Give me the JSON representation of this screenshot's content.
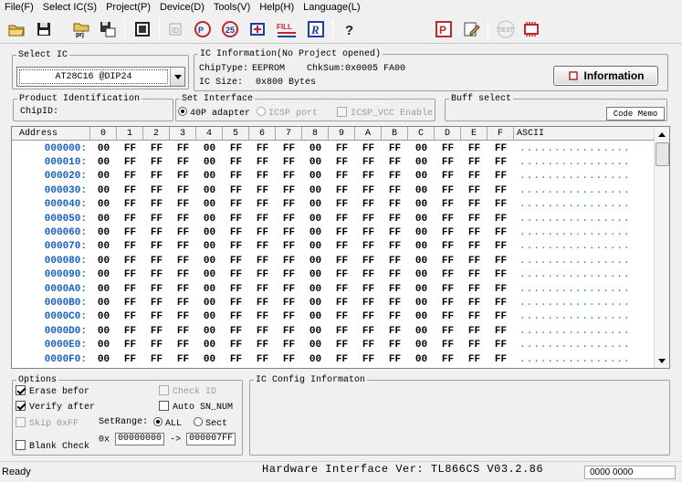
{
  "menu": [
    "File(F)",
    "Select IC(S)",
    "Project(P)",
    "Device(D)",
    "Tools(V)",
    "Help(H)",
    "Language(L)"
  ],
  "toolbar": {
    "prj_label": "prj",
    "fill_label": "FILL",
    "read_label": "R",
    "test_label": "TEST",
    "help_label": "?"
  },
  "select_ic": {
    "legend": "Select IC",
    "value": "AT28C16 @DIP24"
  },
  "ic_info": {
    "legend": "IC Information(No Project opened)",
    "chip_type_label": "ChipType:",
    "chip_type": "EEPROM",
    "checksum_label": "ChkSum:",
    "checksum": "0x0005 FA00",
    "ic_size_label": "IC Size:",
    "ic_size": "0x800 Bytes",
    "button": "Information"
  },
  "product_id": {
    "legend": "Product Identification",
    "chip_id_label": "ChipID:"
  },
  "interface": {
    "legend": "Set Interface",
    "opt_40p": "40P adapter",
    "opt_icsp": "ICSP port",
    "opt_icsp_vcc": "ICSP_VCC Enable"
  },
  "buff": {
    "legend": "Buff select",
    "value": "Code Memo"
  },
  "grid": {
    "address_header": "Address",
    "columns": [
      "0",
      "1",
      "2",
      "3",
      "4",
      "5",
      "6",
      "7",
      "8",
      "9",
      "A",
      "B",
      "C",
      "D",
      "E",
      "F"
    ],
    "ascii_header": "ASCII",
    "rows": [
      {
        "addr": "000000:",
        "bytes": [
          "00",
          "FF",
          "FF",
          "FF",
          "00",
          "FF",
          "FF",
          "FF",
          "00",
          "FF",
          "FF",
          "FF",
          "00",
          "FF",
          "FF",
          "FF"
        ],
        "ascii": "................"
      },
      {
        "addr": "000010:",
        "bytes": [
          "00",
          "FF",
          "FF",
          "FF",
          "00",
          "FF",
          "FF",
          "FF",
          "00",
          "FF",
          "FF",
          "FF",
          "00",
          "FF",
          "FF",
          "FF"
        ],
        "ascii": "................"
      },
      {
        "addr": "000020:",
        "bytes": [
          "00",
          "FF",
          "FF",
          "FF",
          "00",
          "FF",
          "FF",
          "FF",
          "00",
          "FF",
          "FF",
          "FF",
          "00",
          "FF",
          "FF",
          "FF"
        ],
        "ascii": "................"
      },
      {
        "addr": "000030:",
        "bytes": [
          "00",
          "FF",
          "FF",
          "FF",
          "00",
          "FF",
          "FF",
          "FF",
          "00",
          "FF",
          "FF",
          "FF",
          "00",
          "FF",
          "FF",
          "FF"
        ],
        "ascii": "................"
      },
      {
        "addr": "000040:",
        "bytes": [
          "00",
          "FF",
          "FF",
          "FF",
          "00",
          "FF",
          "FF",
          "FF",
          "00",
          "FF",
          "FF",
          "FF",
          "00",
          "FF",
          "FF",
          "FF"
        ],
        "ascii": "................"
      },
      {
        "addr": "000050:",
        "bytes": [
          "00",
          "FF",
          "FF",
          "FF",
          "00",
          "FF",
          "FF",
          "FF",
          "00",
          "FF",
          "FF",
          "FF",
          "00",
          "FF",
          "FF",
          "FF"
        ],
        "ascii": "................"
      },
      {
        "addr": "000060:",
        "bytes": [
          "00",
          "FF",
          "FF",
          "FF",
          "00",
          "FF",
          "FF",
          "FF",
          "00",
          "FF",
          "FF",
          "FF",
          "00",
          "FF",
          "FF",
          "FF"
        ],
        "ascii": "................"
      },
      {
        "addr": "000070:",
        "bytes": [
          "00",
          "FF",
          "FF",
          "FF",
          "00",
          "FF",
          "FF",
          "FF",
          "00",
          "FF",
          "FF",
          "FF",
          "00",
          "FF",
          "FF",
          "FF"
        ],
        "ascii": "................"
      },
      {
        "addr": "000080:",
        "bytes": [
          "00",
          "FF",
          "FF",
          "FF",
          "00",
          "FF",
          "FF",
          "FF",
          "00",
          "FF",
          "FF",
          "FF",
          "00",
          "FF",
          "FF",
          "FF"
        ],
        "ascii": "................"
      },
      {
        "addr": "000090:",
        "bytes": [
          "00",
          "FF",
          "FF",
          "FF",
          "00",
          "FF",
          "FF",
          "FF",
          "00",
          "FF",
          "FF",
          "FF",
          "00",
          "FF",
          "FF",
          "FF"
        ],
        "ascii": "................"
      },
      {
        "addr": "0000A0:",
        "bytes": [
          "00",
          "FF",
          "FF",
          "FF",
          "00",
          "FF",
          "FF",
          "FF",
          "00",
          "FF",
          "FF",
          "FF",
          "00",
          "FF",
          "FF",
          "FF"
        ],
        "ascii": "................"
      },
      {
        "addr": "0000B0:",
        "bytes": [
          "00",
          "FF",
          "FF",
          "FF",
          "00",
          "FF",
          "FF",
          "FF",
          "00",
          "FF",
          "FF",
          "FF",
          "00",
          "FF",
          "FF",
          "FF"
        ],
        "ascii": "................"
      },
      {
        "addr": "0000C0:",
        "bytes": [
          "00",
          "FF",
          "FF",
          "FF",
          "00",
          "FF",
          "FF",
          "FF",
          "00",
          "FF",
          "FF",
          "FF",
          "00",
          "FF",
          "FF",
          "FF"
        ],
        "ascii": "................"
      },
      {
        "addr": "0000D0:",
        "bytes": [
          "00",
          "FF",
          "FF",
          "FF",
          "00",
          "FF",
          "FF",
          "FF",
          "00",
          "FF",
          "FF",
          "FF",
          "00",
          "FF",
          "FF",
          "FF"
        ],
        "ascii": "................"
      },
      {
        "addr": "0000E0:",
        "bytes": [
          "00",
          "FF",
          "FF",
          "FF",
          "00",
          "FF",
          "FF",
          "FF",
          "00",
          "FF",
          "FF",
          "FF",
          "00",
          "FF",
          "FF",
          "FF"
        ],
        "ascii": "................"
      },
      {
        "addr": "0000F0:",
        "bytes": [
          "00",
          "FF",
          "FF",
          "FF",
          "00",
          "FF",
          "FF",
          "FF",
          "00",
          "FF",
          "FF",
          "FF",
          "00",
          "FF",
          "FF",
          "FF"
        ],
        "ascii": "................"
      }
    ]
  },
  "options": {
    "legend": "Options",
    "erase": "Erase befor",
    "verify": "Verify after",
    "skip": "Skip 0xFF",
    "blank": "Blank Check",
    "check_id": "Check ID",
    "auto_sn": "Auto SN_NUM",
    "set_range": "SetRange:",
    "all": "ALL",
    "sect": "Sect",
    "prefix": "0x",
    "range_start": "00000000",
    "arrow": "->",
    "range_end": "000007FF"
  },
  "ic_config": {
    "legend": "IC Config Informaton"
  },
  "status": {
    "left": "Ready",
    "hardware": "Hardware Interface Ver: TL866CS V03.2.86",
    "right": "0000 0000"
  },
  "colors": {
    "address": "#1560c0",
    "ascii": "#1a78d0",
    "accent_red": "#c0282d"
  }
}
